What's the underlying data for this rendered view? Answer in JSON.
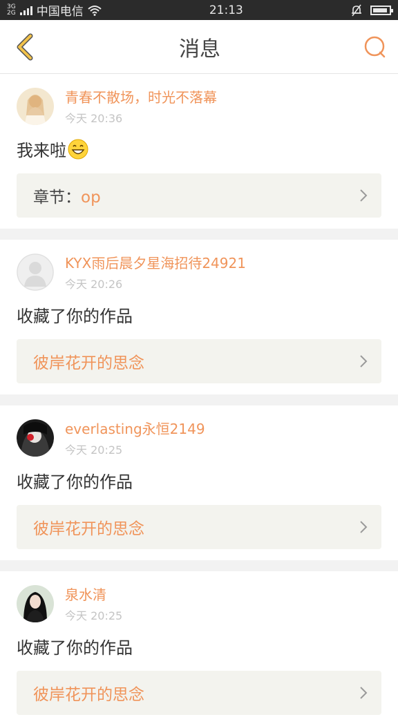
{
  "status": {
    "network_top": "3G",
    "network_bottom": "2G",
    "carrier": "中国电信",
    "time": "21:13"
  },
  "header": {
    "title": "消息"
  },
  "messages": [
    {
      "username": "青春不散场，时光不落幕",
      "time": "今天 20:36",
      "body": "我来啦",
      "link_prefix": "章节：",
      "link": "op"
    },
    {
      "username": "KYX雨后晨夕星海招待24921",
      "time": "今天 20:26",
      "body": "收藏了你的作品",
      "link": "彼岸花开的思念"
    },
    {
      "username": "everlasting永恒2149",
      "time": "今天 20:25",
      "body": "收藏了你的作品",
      "link": "彼岸花开的思念"
    },
    {
      "username": "泉水清",
      "time": "今天 20:25",
      "body": "收藏了你的作品",
      "link": "彼岸花开的思念"
    }
  ],
  "colors": {
    "accent": "#f0945a",
    "back_icon": "#f2c24a"
  },
  "icons": [
    "back-icon",
    "search-icon",
    "chevron-right-icon",
    "wifi-icon",
    "mute-icon",
    "battery-icon",
    "grin-emoji-icon"
  ]
}
